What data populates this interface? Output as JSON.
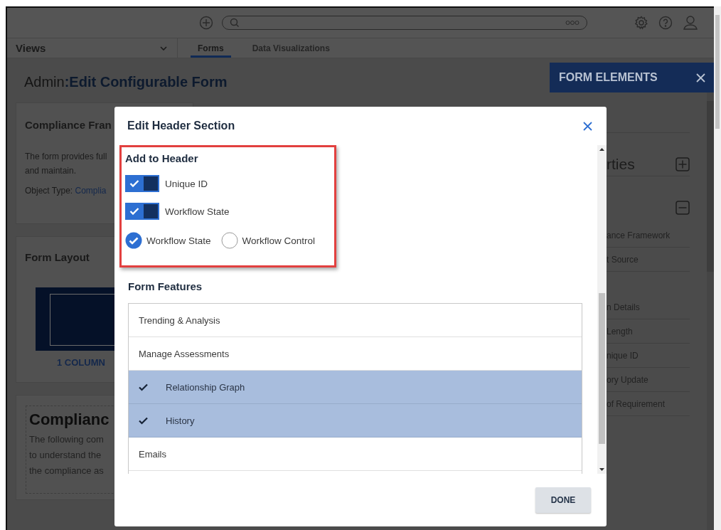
{
  "top_bar": {
    "search": {
      "kind": "search"
    }
  },
  "nav": {
    "views_label": "Views",
    "tabs": [
      {
        "label": "Forms",
        "selected": true
      },
      {
        "label": "Data Visualizations",
        "selected": false
      }
    ]
  },
  "page_title": {
    "prefix": "Admin",
    "title": ":Edit Configurable Form"
  },
  "cards": [
    {
      "kind": "info",
      "title": "Compliance Fran",
      "lines": [
        "The form provides full",
        "and maintain."
      ],
      "object_type_label": "Object Type:",
      "object_type_value": "Complia"
    },
    {
      "kind": "layout",
      "title": "Form Layout",
      "layout_label": "1 COLUMN"
    },
    {
      "kind": "preview",
      "heading": "Complianc",
      "lines": [
        "The following com",
        "to understand the",
        "the compliance as"
      ]
    }
  ],
  "form_elements_panel": {
    "title": "FORM ELEMENTS",
    "sections": [
      {
        "label": "rties",
        "expanded": false
      },
      {
        "expanded": true,
        "items": [
          "ance Framework",
          "t Source",
          "n Details",
          "Length",
          "nique ID",
          "ory Update",
          "of Requirement"
        ]
      }
    ]
  },
  "modal": {
    "title": "Edit Header Section",
    "add_to_header": {
      "title": "Add to Header",
      "highlighted": true,
      "toggles": [
        {
          "label": "Unique ID",
          "checked": true
        },
        {
          "label": "Workflow State",
          "checked": true
        }
      ],
      "radios": [
        {
          "label": "Workflow State",
          "selected": true
        },
        {
          "label": "Workflow Control",
          "selected": false
        }
      ]
    },
    "form_features": {
      "title": "Form Features",
      "items": [
        {
          "label": "Trending & Analysis",
          "checked": false
        },
        {
          "label": "Manage Assessments",
          "checked": false
        },
        {
          "label": "Relationship Graph",
          "checked": true
        },
        {
          "label": "History",
          "checked": true
        },
        {
          "label": "Emails",
          "checked": false
        }
      ]
    },
    "done_button": "DONE"
  }
}
